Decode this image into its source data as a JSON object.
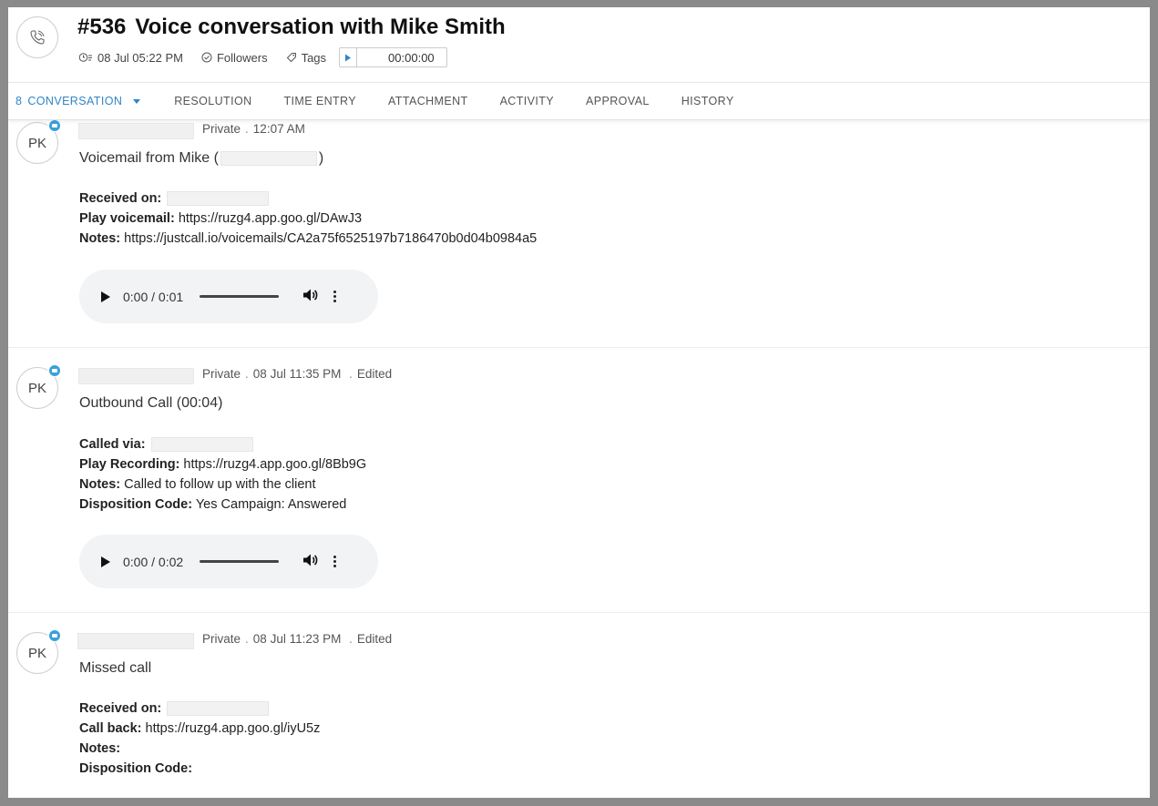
{
  "header": {
    "ticket_id": "#536",
    "title": "Voice conversation with Mike Smith",
    "created": "08 Jul 05:22 PM",
    "followers_label": "Followers",
    "tags_label": "Tags",
    "timer": "00:00:00"
  },
  "tabs": [
    {
      "label": "CONVERSATION",
      "count": "8",
      "active": true
    },
    {
      "label": "RESOLUTION"
    },
    {
      "label": "TIME ENTRY"
    },
    {
      "label": "ATTACHMENT"
    },
    {
      "label": "ACTIVITY"
    },
    {
      "label": "APPROVAL"
    },
    {
      "label": "HISTORY"
    }
  ],
  "entries": [
    {
      "avatar": "PK",
      "visibility": "Private",
      "time": "12:07 AM",
      "edited": "",
      "title_prefix": "Voicemail from Mike (",
      "title_suffix": ")",
      "fields": [
        {
          "label": "Received on:",
          "value": ""
        },
        {
          "label": "Play voicemail:",
          "value": "https://ruzg4.app.goo.gl/DAwJ3"
        },
        {
          "label": "Notes:",
          "value": "https://justcall.io/voicemails/CA2a75f6525197b7186470b0d04b0984a5"
        }
      ],
      "audio_time": "0:00 / 0:01"
    },
    {
      "avatar": "PK",
      "visibility": "Private",
      "time": "08 Jul 11:35 PM",
      "edited": "Edited",
      "title": "Outbound Call (00:04)",
      "fields": [
        {
          "label": "Called via:",
          "value": ""
        },
        {
          "label": "Play Recording:",
          "value": "https://ruzg4.app.goo.gl/8Bb9G"
        },
        {
          "label": "Notes:",
          "value": "Called to follow up with the client"
        },
        {
          "label": "Disposition Code:",
          "value": "Yes Campaign: Answered"
        }
      ],
      "audio_time": "0:00 / 0:02"
    },
    {
      "avatar": "PK",
      "visibility": "Private",
      "time": "08 Jul 11:23 PM",
      "edited": "Edited",
      "title": "Missed call",
      "fields": [
        {
          "label": "Received on:",
          "value": ""
        },
        {
          "label": "Call back:",
          "value": "https://ruzg4.app.goo.gl/iyU5z"
        },
        {
          "label": "Notes:",
          "value": ""
        },
        {
          "label": "Disposition Code:",
          "value": ""
        }
      ]
    }
  ],
  "colors": {
    "accent": "#2f86c6",
    "badge": "#3aa0dc",
    "audio_bg": "#f1f3f4"
  }
}
